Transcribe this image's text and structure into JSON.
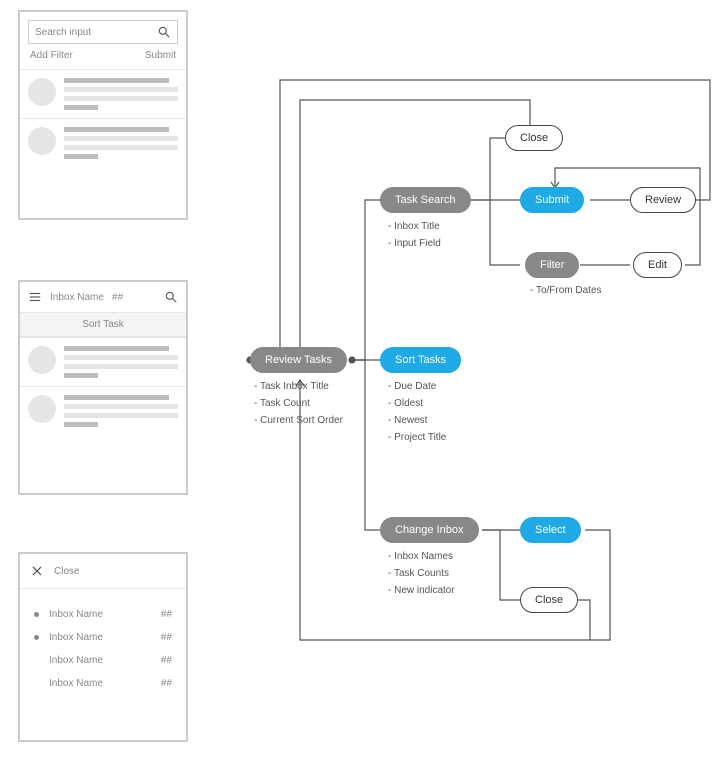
{
  "wireframes": {
    "search_card": {
      "search_placeholder": "Search input",
      "add_filter_label": "Add Filter",
      "submit_label": "Submit"
    },
    "inbox_card": {
      "inbox_name_label": "Inbox Name",
      "count_label": "##",
      "sort_task_label": "Sort Task"
    },
    "menu_card": {
      "close_label": "Close",
      "rows": [
        {
          "label": "Inbox Name",
          "count": "##",
          "new": true
        },
        {
          "label": "Inbox Name",
          "count": "##",
          "new": true
        },
        {
          "label": "Inbox Name",
          "count": "##",
          "new": false
        },
        {
          "label": "Inbox Name",
          "count": "##",
          "new": false
        }
      ]
    }
  },
  "flow": {
    "close_top": "Close",
    "task_search": {
      "label": "Task Search",
      "details": [
        "Inbox Title",
        "Input Field"
      ]
    },
    "submit": "Submit",
    "review": "Review",
    "filter": {
      "label": "Filter",
      "details": [
        "To/From Dates"
      ]
    },
    "edit": "Edit",
    "review_tasks": {
      "label": "Review Tasks",
      "details": [
        "Task Inbox Title",
        "Task Count",
        "Current Sort Order"
      ]
    },
    "sort_tasks": {
      "label": "Sort Tasks",
      "details": [
        "Due Date",
        "Oldest",
        "Newest",
        "Project Title"
      ]
    },
    "change_inbox": {
      "label": "Change Inbox",
      "details": [
        "Inbox Names",
        "Task Counts",
        "New indicator"
      ]
    },
    "select": "Select",
    "close_bottom": "Close"
  }
}
